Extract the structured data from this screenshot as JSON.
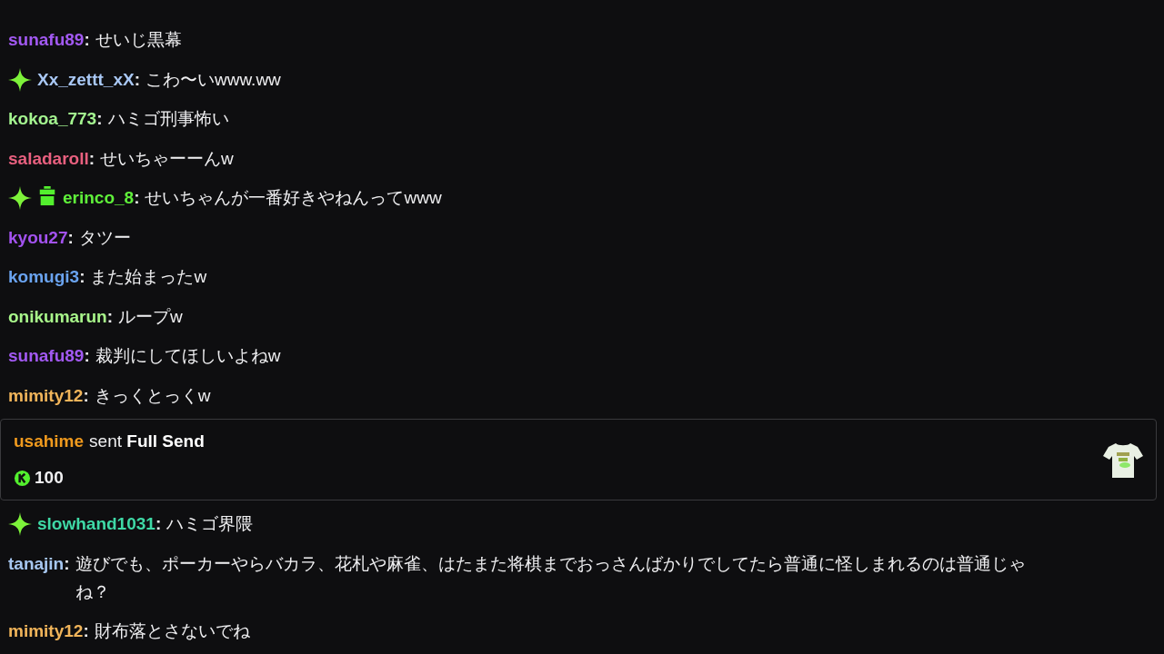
{
  "name_separator": ":",
  "messages": [
    {
      "kind": "chat",
      "user": "sunafu89",
      "color": "#a259f2",
      "text": "せいじ黒幕"
    },
    {
      "kind": "chat",
      "badges": [
        {
          "kind": "sparkle"
        }
      ],
      "user": "Xx_zettt_xX",
      "color": "#a9c8f5",
      "text": "こわ〜いwww.ww"
    },
    {
      "kind": "chat",
      "user": "kokoa_773",
      "color": "#a4f590",
      "text": "ハミゴ刑事怖い"
    },
    {
      "kind": "chat",
      "user": "saladaroll",
      "color": "#e8607f",
      "text": "せいちゃーーんw"
    },
    {
      "kind": "chat",
      "badges": [
        {
          "kind": "sparkle"
        },
        {
          "kind": "gift"
        }
      ],
      "user": "erinco_8",
      "color": "#5ff03a",
      "text": "せいちゃんが一番好きやねんってwww"
    },
    {
      "kind": "chat",
      "user": "kyou27",
      "color": "#a352f0",
      "text": "タツー"
    },
    {
      "kind": "chat",
      "user": "komugi3",
      "color": "#6aa3ef",
      "text": "また始まったw"
    },
    {
      "kind": "chat",
      "user": "onikumarun",
      "color": "#a8f58a",
      "text": "ループw"
    },
    {
      "kind": "chat",
      "user": "sunafu89",
      "color": "#a259f2",
      "text": "裁判にしてほしいよねw"
    },
    {
      "kind": "chat",
      "user": "mimity12",
      "color": "#f0b45a",
      "text": "きっくとっくw"
    },
    {
      "kind": "gift_event",
      "user": "usahime",
      "color": "#f09a1e",
      "text": "sent **Full Send**",
      "amount": "100"
    },
    {
      "kind": "chat",
      "badges": [
        {
          "kind": "sparkle"
        }
      ],
      "user": "slowhand1031",
      "color": "#3fd9a6",
      "text": "ハミゴ界隈"
    },
    {
      "kind": "chat",
      "user": "tanajin",
      "color": "#a7c7f0",
      "text": "遊びでも、ポーカーやらバカラ、花札や麻雀、はたまた将棋までおっさんばかりでしてたら普通に怪しまれるのは普通じゃね？"
    },
    {
      "kind": "chat",
      "user": "mimity12",
      "color": "#f0b45a",
      "text": "財布落とさないでね"
    }
  ]
}
